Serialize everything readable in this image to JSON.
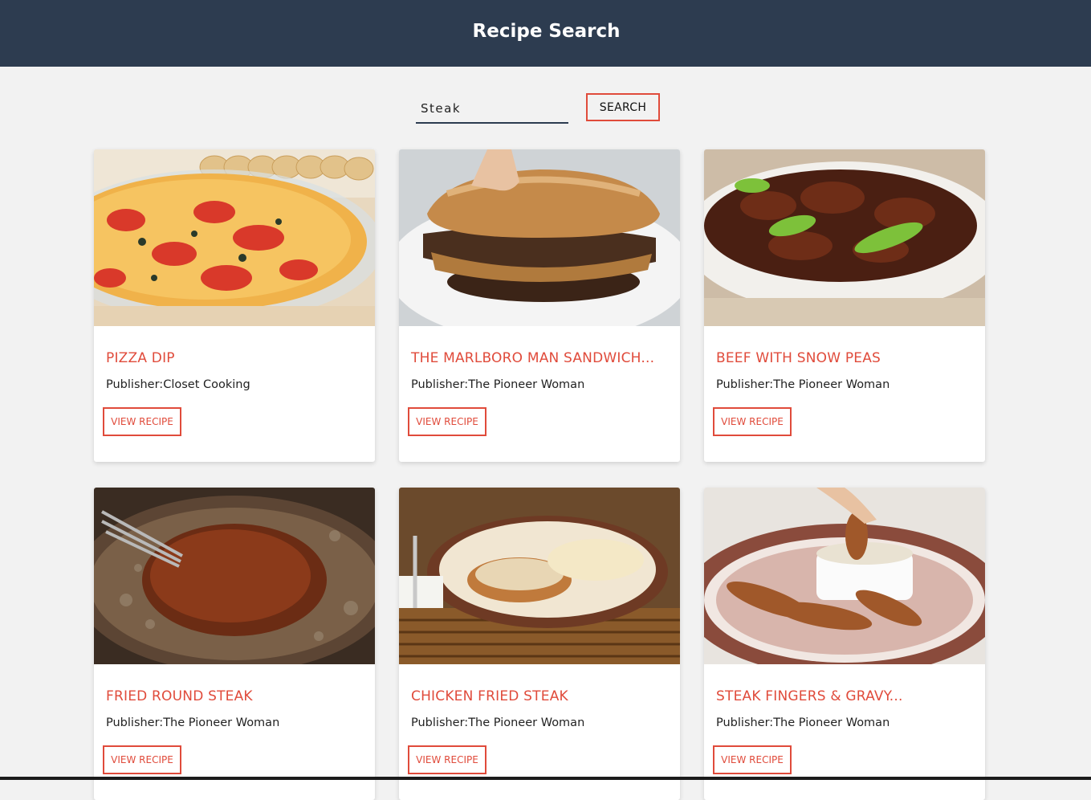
{
  "header": {
    "title": "Recipe Search"
  },
  "search": {
    "value": "Steak",
    "button_label": "SEARCH"
  },
  "recipes": [
    {
      "title": "PIZZA DIP",
      "publisher": "Publisher:Closet Cooking",
      "button": "VIEW RECIPE",
      "image": "pizza-dip-photo"
    },
    {
      "title": "THE MARLBORO MAN SANDWICH...",
      "publisher": "Publisher:The Pioneer Woman",
      "button": "VIEW RECIPE",
      "image": "steak-sandwich-photo"
    },
    {
      "title": "BEEF WITH SNOW PEAS",
      "publisher": "Publisher:The Pioneer Woman",
      "button": "VIEW RECIPE",
      "image": "beef-snow-peas-photo"
    },
    {
      "title": "FRIED ROUND STEAK",
      "publisher": "Publisher:The Pioneer Woman",
      "button": "VIEW RECIPE",
      "image": "fried-steak-pan-photo"
    },
    {
      "title": "CHICKEN FRIED STEAK",
      "publisher": "Publisher:The Pioneer Woman",
      "button": "VIEW RECIPE",
      "image": "chicken-fried-steak-photo"
    },
    {
      "title": "STEAK FINGERS & GRAVY...",
      "publisher": "Publisher:The Pioneer Woman",
      "button": "VIEW RECIPE",
      "image": "steak-fingers-photo"
    }
  ],
  "colors": {
    "header_bg": "#2d3c50",
    "accent": "#e04b3b",
    "page_bg": "#f2f2f2"
  }
}
